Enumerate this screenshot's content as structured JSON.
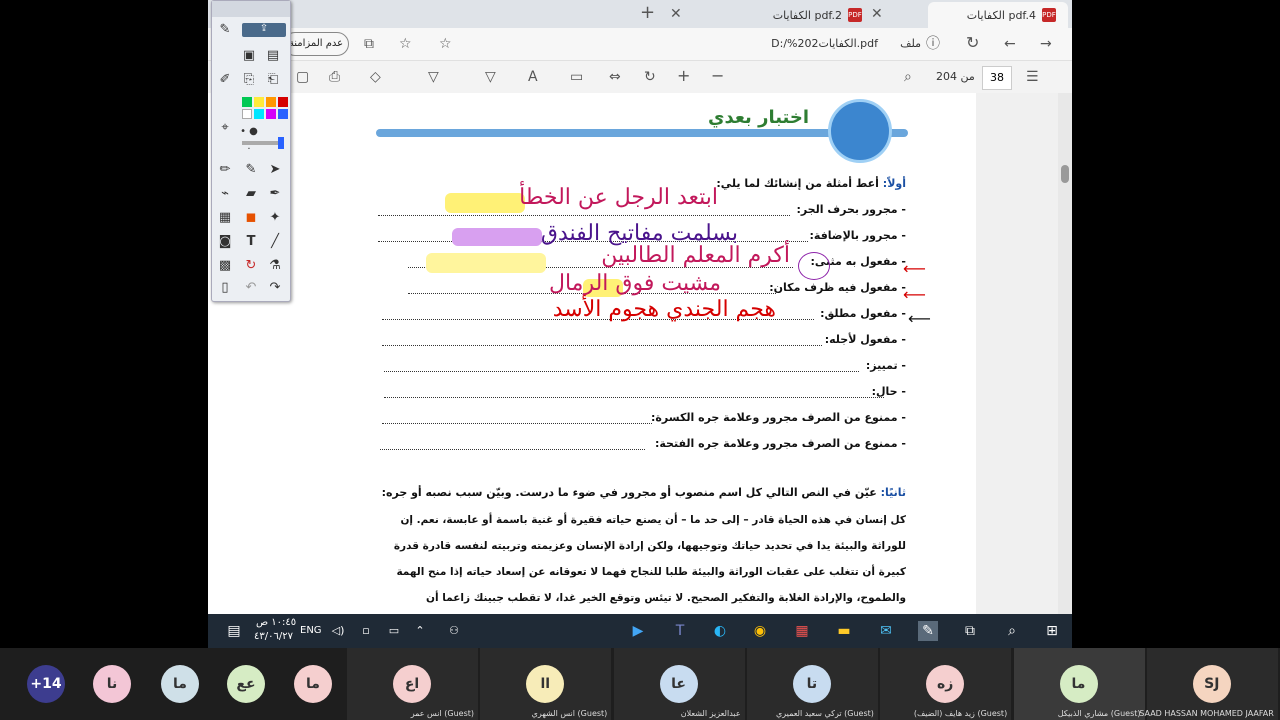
{
  "tabs": [
    {
      "label": "الكفايات pdf.4"
    },
    {
      "label": "الكفايات pdf.2"
    }
  ],
  "address": {
    "prefix": "ملف",
    "url": "D:/%202الكفايات.pdf",
    "sync_button": "عدم المزامنة"
  },
  "pdf_toolbar": {
    "page_current": "38",
    "page_total": "من 204"
  },
  "page": {
    "header_title": "اختبار بعدي",
    "q1_label": "أولاً:",
    "q1_text": "أعط أمثلة من إنشائك لما يلي:",
    "items": [
      "- مجرور بحرف الجر:",
      "- مجرور بالإضافة:",
      "- مفعول به مثنى:",
      "- مفعول فيه ظرف مكان:",
      "- مفعول مطلق:",
      "- مفعول لأجله:",
      "- تمييز:",
      "- حال:",
      "- ممنوع من الصرف مجرور وعلامة جره الكسرة:",
      "- ممنوع من الصرف مجرور وعلامة جره الفتحة:"
    ],
    "q2_label": "ثانيًا:",
    "q2_text": "عيّن في النص التالي كل اسم منصوب أو مجرور في ضوء ما درست. وبيّن سبب نصبه أو جره:",
    "paragraph": [
      "كل إنسان في هذه الحياة قادر – إلى حد ما – أن يصنع حياته فقيرة أو غنية باسمة أو عابسة، نعم. إن",
      "للوراثة والبيئة يدا في تحديد حياتك وتوجيهها، ولكن إرادة الإنسان وعزيمته وتربيته لنفسه قادرة قدرة",
      "كبيرة أن تتغلب على عقبات الوراثة والبيئة طلبا للنجاح فهما لا تعوقانه عن إسعاد حياته إذا منح الهمة",
      "والطموح، والإرادة الغلابة والتفكير الصحيح. لا تيئس وتوقع الخير غدا، لا تقطب جبينك زاعما أن"
    ],
    "handwriting": [
      "ابتعد الرجل عن الخطأ",
      "بسلمت مفاتيح الفندق",
      "أكرم المعلم الطالبين",
      "مشيت فوق الرمال",
      "هجم الجندي هجوم الأسد"
    ]
  },
  "taskbar": {
    "time": "١٠:٤٥ ص",
    "date": "٤٣/٠٦/٢٧",
    "lang": "ENG"
  },
  "participants": [
    {
      "initials": "+14",
      "name": "",
      "color": "#3d3d8f"
    },
    {
      "initials": "نا",
      "name": "",
      "color": "#f3c6d6"
    },
    {
      "initials": "ما",
      "name": "",
      "color": "#cfe0e8"
    },
    {
      "initials": "عع",
      "name": "",
      "color": "#d6ecc4"
    },
    {
      "initials": "ما",
      "name": "",
      "color": "#f5cfcf"
    },
    {
      "initials": "اع",
      "name": "انس عمر (Guest)",
      "color": "#f5cfcf"
    },
    {
      "initials": "اا",
      "name": "انس الشهري (Guest)",
      "color": "#f7ecb8"
    },
    {
      "initials": "عا",
      "name": "عبدالعزيز الشعلان",
      "color": "#c8dcf0"
    },
    {
      "initials": "تا",
      "name": "تركي سعيد العميري (Guest)",
      "color": "#c8dcf0"
    },
    {
      "initials": "زه",
      "name": "زيد هايف (الضيف) (Guest)",
      "color": "#f5cfcf"
    },
    {
      "initials": "ما",
      "name": "مشاري الذبيكل (Guest)",
      "color": "#d6ecc4"
    },
    {
      "initials": "SJ",
      "name": "SAAD HASSAN MOHAMED JAAFAR",
      "color": "#f5d5c0"
    }
  ]
}
